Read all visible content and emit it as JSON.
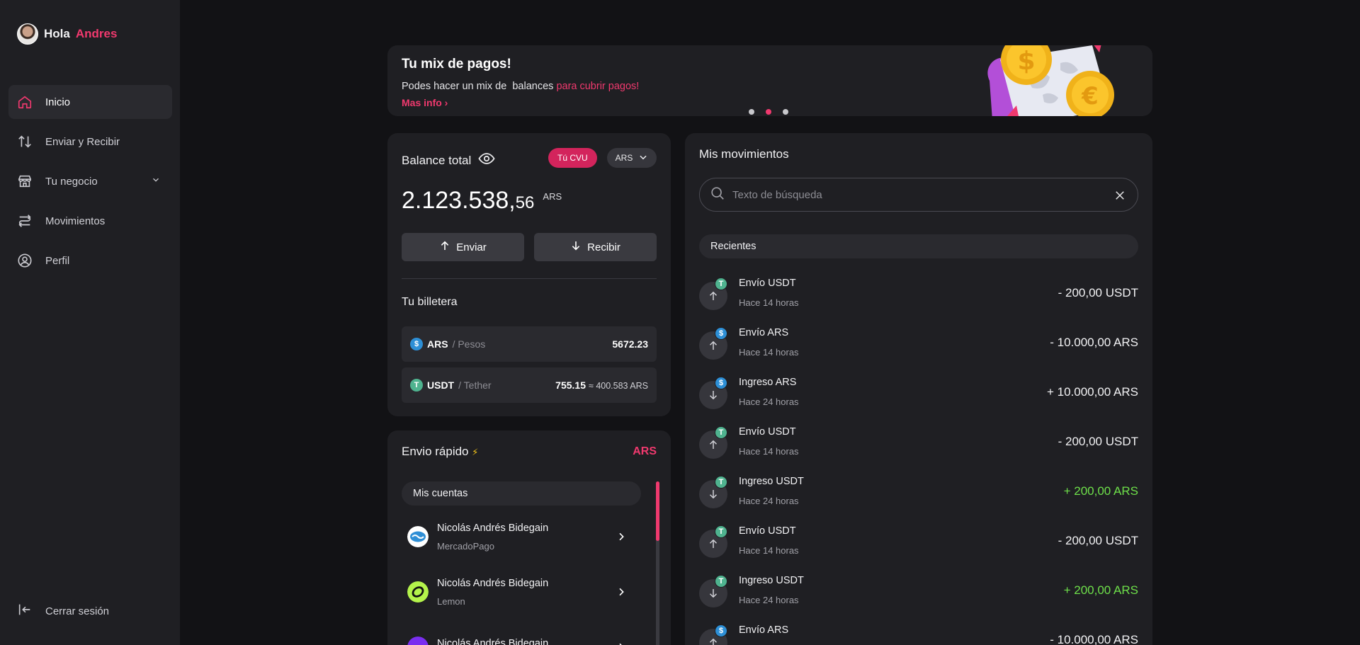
{
  "user": {
    "greeting": "Hola",
    "name": "Andres"
  },
  "nav": {
    "items": [
      {
        "label": "Inicio",
        "icon": "home-icon",
        "active": true
      },
      {
        "label": "Enviar y Recibir",
        "icon": "transfer-arrows-icon"
      },
      {
        "label": "Tu negocio",
        "icon": "store-icon",
        "expandable": true
      },
      {
        "label": "Movimientos",
        "icon": "route-icon"
      },
      {
        "label": "Perfil",
        "icon": "user-circle-icon"
      }
    ],
    "logout": "Cerrar sesión"
  },
  "banner": {
    "title": "Tu mix de pagos!",
    "text": "Podes hacer un mix de  balances ",
    "highlight": "para cubrir pagos!",
    "link": "Mas info ›",
    "slides": 3,
    "active_slide": 1
  },
  "balance": {
    "title": "Balance total",
    "cvu_label": "Tú CVU",
    "currency_select": "ARS",
    "amount_int": "2.123.538,",
    "amount_dec": "56",
    "amount_currency": "ARS",
    "send_label": "Enviar",
    "receive_label": "Recibir",
    "wallet_title": "Tu billetera",
    "wallet": [
      {
        "symbol": "ARS",
        "name": "/ Pesos",
        "badge": "$",
        "value": "5672.23",
        "conversion": ""
      },
      {
        "symbol": "USDT",
        "name": "/ Tether",
        "badge": "T",
        "value": "755.15",
        "conversion": "≈ 400.583 ARS"
      }
    ]
  },
  "quick_send": {
    "title": "Envio rápido",
    "bolt": "⚡",
    "currency": "ARS",
    "accounts_label": "Mis cuentas",
    "accounts": [
      {
        "name": "Nicolás Andrés Bidegain",
        "provider": "MercadoPago"
      },
      {
        "name": "Nicolás Andrés Bidegain",
        "provider": "Lemon"
      },
      {
        "name": "Nicolás Andrés Bidegain",
        "provider": ""
      }
    ]
  },
  "movements": {
    "title": "Mis movimientos",
    "search_placeholder": "Texto de búsqueda",
    "recent_label": "Recientes",
    "items": [
      {
        "title": "Envío USDT",
        "time": "Hace 14 horas",
        "amount": "- 200,00 USDT",
        "direction": "out",
        "coin": "T",
        "positive": false
      },
      {
        "title": "Envío ARS",
        "time": "Hace 14 horas",
        "amount": "- 10.000,00 ARS",
        "direction": "out",
        "coin": "$",
        "positive": false
      },
      {
        "title": "Ingreso ARS",
        "time": "Hace 24 horas",
        "amount": "+ 10.000,00 ARS",
        "direction": "in",
        "coin": "$",
        "positive": false
      },
      {
        "title": "Envío USDT",
        "time": "Hace 14 horas",
        "amount": "- 200,00 USDT",
        "direction": "out",
        "coin": "T",
        "positive": false
      },
      {
        "title": "Ingreso USDT",
        "time": "Hace 24 horas",
        "amount": "+ 200,00 ARS",
        "direction": "in",
        "coin": "T",
        "positive": true
      },
      {
        "title": "Envío USDT",
        "time": "Hace 14 horas",
        "amount": "- 200,00 USDT",
        "direction": "out",
        "coin": "T",
        "positive": false
      },
      {
        "title": "Ingreso USDT",
        "time": "Hace 24 horas",
        "amount": "+ 200,00 ARS",
        "direction": "in",
        "coin": "T",
        "positive": true
      },
      {
        "title": "Envío ARS",
        "time": "",
        "amount": "- 10.000,00 ARS",
        "direction": "out",
        "coin": "$",
        "positive": false
      }
    ]
  },
  "colors": {
    "accent": "#f0396e",
    "positive": "#6ee04a",
    "ars_coin": "#2d8fd6",
    "usdt_coin": "#4fb38f"
  }
}
